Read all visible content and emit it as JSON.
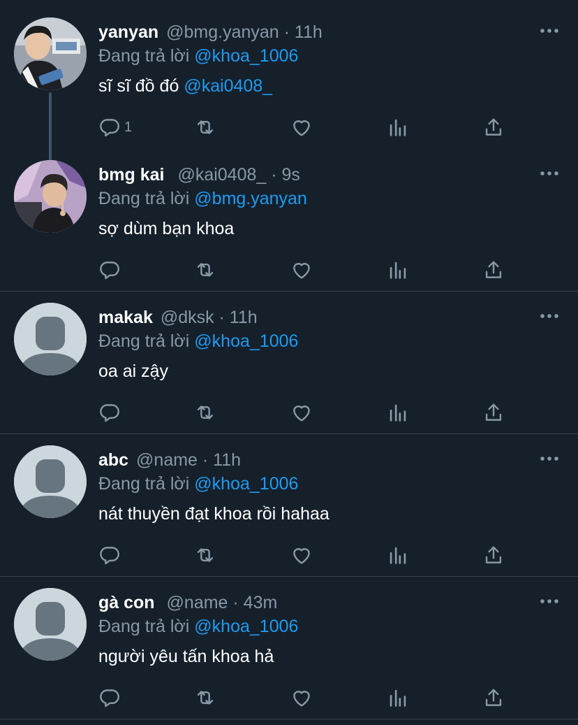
{
  "replies": [
    {
      "name": "yanyan",
      "meta": "@bmg.yanyan · 11h",
      "reply_prefix": "Đang trả lời",
      "reply_to": "@khoa_1006",
      "text": "sĩ sĩ đồ đó",
      "mention": "@kai0408_",
      "reply_count": "1",
      "avatar": "photo-avatar"
    },
    {
      "name": "bmg kai",
      "meta": "@kai0408_ · 9s",
      "reply_prefix": "Đang trả lời",
      "reply_to": "@bmg.yanyan",
      "text": "sợ dùm bạn khoa",
      "reply_count": "",
      "avatar": "photo-avatar"
    },
    {
      "name": "makak",
      "meta": "@dksk · 11h",
      "reply_prefix": "Đang trả lời",
      "reply_to": "@khoa_1006",
      "text": "oa ai zậy",
      "reply_count": "",
      "avatar": "default-avatar"
    },
    {
      "name": "abc",
      "meta": "@name · 11h",
      "reply_prefix": "Đang trả lời",
      "reply_to": "@khoa_1006",
      "text": "nát thuyền đạt khoa rồi hahaa",
      "reply_count": "",
      "avatar": "default-avatar"
    },
    {
      "name": "gà con",
      "meta": "@name · 43m",
      "reply_prefix": "Đang trả lời",
      "reply_to": "@khoa_1006",
      "text": "người yêu tấn khoa hả",
      "reply_count": "",
      "avatar": "default-avatar"
    }
  ],
  "icons": {
    "reply": "reply-icon",
    "retweet": "retweet-icon",
    "like": "heart-icon",
    "views": "analytics-icon",
    "share": "share-icon",
    "more": "more-icon"
  },
  "colors": {
    "background": "#15202b",
    "text": "#ffffff",
    "secondary": "#8899a6",
    "accent": "#1d9bf0",
    "divider": "#38444d"
  }
}
